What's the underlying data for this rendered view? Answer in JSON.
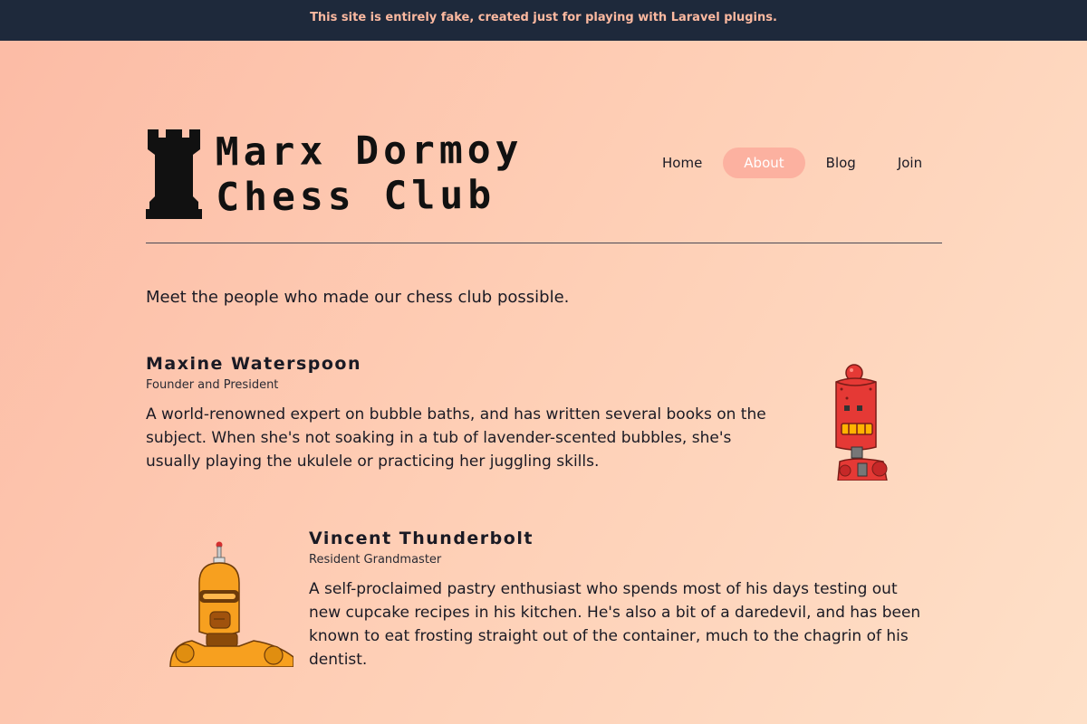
{
  "banner": {
    "text": "This site is entirely fake, created just for playing with Laravel plugins."
  },
  "logo": {
    "line1": "Marx Dormoy",
    "line2": "Chess Club",
    "icon": "rook-icon"
  },
  "nav": {
    "items": [
      {
        "label": "Home",
        "active": false
      },
      {
        "label": "About",
        "active": true
      },
      {
        "label": "Blog",
        "active": false
      },
      {
        "label": "Join",
        "active": false
      }
    ]
  },
  "intro": "Meet the people who made our chess club possible.",
  "people": [
    {
      "name": "Maxine Waterspoon",
      "role": "Founder and President",
      "bio": "A world-renowned expert on bubble baths, and has written several books on the subject. When she's not soaking in a tub of lavender-scented bubbles, she's usually playing the ukulele or practicing her juggling skills.",
      "avatar": "red-robot-avatar"
    },
    {
      "name": "Vincent Thunderbolt",
      "role": "Resident Grandmaster",
      "bio": "A self-proclaimed pastry enthusiast who spends most of his days testing out new cupcake recipes in his kitchen. He's also a bit of a daredevil, and has been known to eat frosting straight out of the container, much to the chagrin of his dentist.",
      "avatar": "orange-robot-avatar"
    }
  ],
  "colors": {
    "banner_bg": "#1e293b",
    "banner_text": "#fcb9a0",
    "nav_active_bg": "#fcb1a0"
  }
}
